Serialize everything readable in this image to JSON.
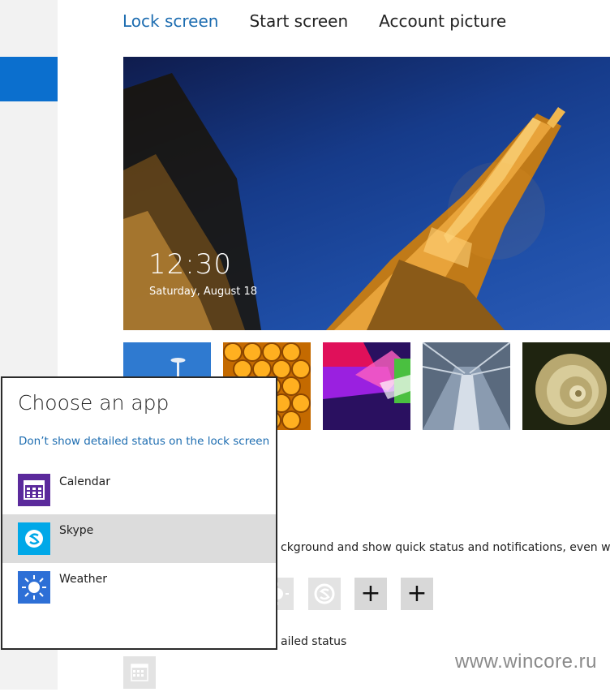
{
  "tabs": [
    {
      "label": "Lock screen",
      "active": true
    },
    {
      "label": "Start screen",
      "active": false
    },
    {
      "label": "Account picture",
      "active": false
    }
  ],
  "lock_preview": {
    "time": "12:30",
    "date": "Saturday, August 18"
  },
  "background_thumbnails": [
    "space-needle",
    "honeycomb",
    "geometric-shapes",
    "tunnel-tracks",
    "nautilus-shell"
  ],
  "lock_apps": {
    "description_partial": "ckground and show quick status and notifications, even when",
    "slots": [
      {
        "icon": "weather-icon"
      },
      {
        "icon": "skype-icon"
      },
      {
        "icon": "plus-icon",
        "glyph": "+"
      },
      {
        "icon": "plus-icon",
        "glyph": "+"
      }
    ],
    "detailed_status_partial": "ailed status",
    "detailed_slot_icon": "calendar-icon"
  },
  "flyout": {
    "title": "Choose an app",
    "link": "Don’t show detailed status on the lock screen",
    "apps": [
      {
        "label": "Calendar",
        "icon": "calendar-icon",
        "color": "#5b2a9c",
        "selected": false
      },
      {
        "label": "Skype",
        "icon": "skype-icon",
        "color": "#00a8e8",
        "selected": true
      },
      {
        "label": "Weather",
        "icon": "weather-icon",
        "color": "#2d6fd6",
        "selected": false
      }
    ]
  },
  "watermark": "www.wincore.ru",
  "colors": {
    "accent": "#1c6cb0",
    "nav_selected": "#0b6fce",
    "selected_row": "#dcdcdc"
  }
}
